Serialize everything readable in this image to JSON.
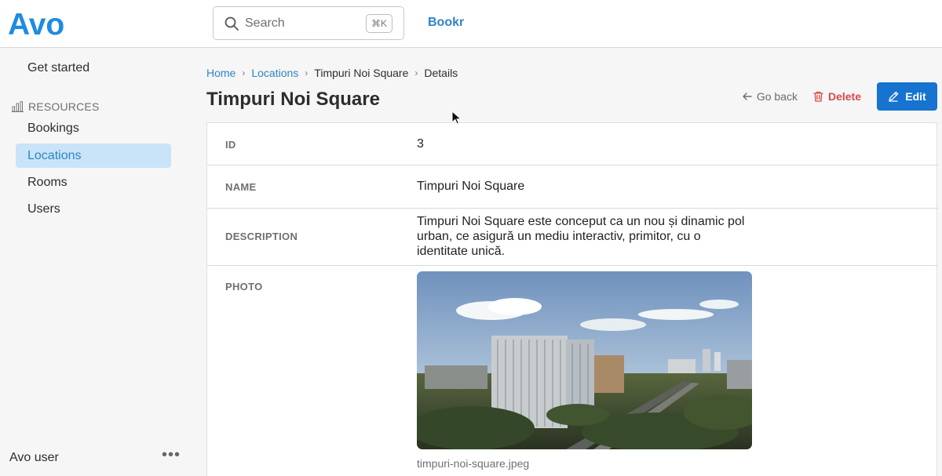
{
  "brand": {
    "logo_text": "Avo",
    "app_name": "Bookr",
    "accent": "#2f84c5",
    "edit_blue": "#1673d0",
    "delete_red": "#d9484a"
  },
  "search": {
    "placeholder": "Search",
    "shortcut": "⌘K"
  },
  "sidebar": {
    "get_started": "Get started",
    "section_title": "RESOURCES",
    "items": [
      {
        "label": "Bookings",
        "active": false
      },
      {
        "label": "Locations",
        "active": true
      },
      {
        "label": "Rooms",
        "active": false
      },
      {
        "label": "Users",
        "active": false
      }
    ],
    "user_name": "Avo user",
    "user_menu": "•••"
  },
  "breadcrumb": [
    "Home",
    "Locations",
    "Timpuri Noi Square",
    "Details"
  ],
  "page_title": "Timpuri Noi Square",
  "actions": {
    "go_back": "Go back",
    "delete": "Delete",
    "edit": "Edit"
  },
  "details": {
    "id_label": "ID",
    "id_value": "3",
    "name_label": "NAME",
    "name_value": "Timpuri Noi Square",
    "description_label": "DESCRIPTION",
    "description_lines": [
      "Timpuri Noi Square este conceput ca un nou și dinamic pol",
      "urban, ce asigură un mediu interactiv, primitor, cu o",
      "identitate unică."
    ],
    "photo_label": "PHOTO",
    "photo_filename": "timpuri-noi-square.jpeg"
  },
  "icons": {
    "search": "search-icon",
    "resources": "bar-chart-icon",
    "go_back": "arrow-left-icon",
    "delete": "trash-icon",
    "edit": "pencil-icon"
  }
}
